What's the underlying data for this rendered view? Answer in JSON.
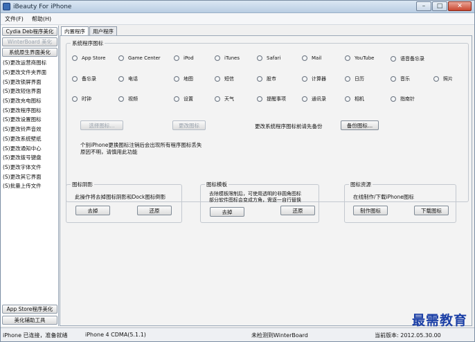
{
  "window": {
    "title": "iBeauty For iPhone",
    "buttons": {
      "minimize": "–",
      "maximize": "□",
      "close": "✕"
    }
  },
  "menu": [
    "文件(F)",
    "帮助(H)"
  ],
  "sidebar": {
    "top_buttons": [
      "Cydia Deb程序美化",
      "WinterBoard 美化",
      "系统原生界面美化"
    ],
    "items": [
      "(S)更改运营商图标",
      "(S)更改文件夹界面",
      "(S)更改锁屏界面",
      "(S)更改短信界面",
      "(S)更改充电图标",
      "(S)更改程序图标",
      "(S)更改设置图标",
      "(S)更改铃声音效",
      "(S)更改系统壁纸",
      "(S)更改通知中心",
      "(S)更改拨号键盘",
      "(S)更改字体文件",
      "(S)更改其它界面",
      "(S)批量上传文件"
    ],
    "bottom_buttons": [
      "App Store程序美化",
      "美化辅助工具"
    ]
  },
  "tabs": [
    "内置程序",
    "用户程序"
  ],
  "system_icons": {
    "legend": "系统程序图标",
    "rows": [
      [
        "App Store",
        "Game Center",
        "iPod",
        "iTunes",
        "Safari",
        "Mail",
        "YouTube",
        "语音备忘录"
      ],
      [
        "备忘录",
        "电话",
        "地图",
        "短信",
        "股市",
        "计算器",
        "日历",
        "音乐",
        "照片"
      ],
      [
        "时钟",
        "视频",
        "设置",
        "天气",
        "提醒事项",
        "通讯录",
        "相机",
        "指南针"
      ]
    ],
    "select_icon_btn": "选择图标...",
    "change_icon_btn": "更改图标",
    "backup_hint": "更改系统程序图标前请先备份",
    "backup_btn": "备份图标...",
    "note_line1": "个别iPhone更换图标注销后会出现所有程序图标丢失",
    "note_line2": "原因不明，请慎用此功能"
  },
  "shadow": {
    "legend": "图标阴影",
    "desc": "此操作将去掉图标阴影和Dock图标倒影",
    "remove_btn": "去掉",
    "restore_btn": "还原"
  },
  "template": {
    "legend": "图标模板",
    "desc1": "去除模板限制后，可使用透明的非圆角图标",
    "desc2": "部分软件图标会变成方角，需逐一自行替换",
    "remove_btn": "去掉",
    "restore_btn": "还原"
  },
  "resources": {
    "legend": "图标资源",
    "desc": "在线制作/下载iPhone图标",
    "make_btn": "制作图标",
    "download_btn": "下载图标"
  },
  "status": {
    "connection": "iPhone 已连接，准备就绪",
    "device": "iPhone 4 CDMA(5.1.1)",
    "winterboard": "未检测到WinterBoard",
    "version": "当前版本: 2012.05.30.00"
  },
  "watermark": "最需教育"
}
